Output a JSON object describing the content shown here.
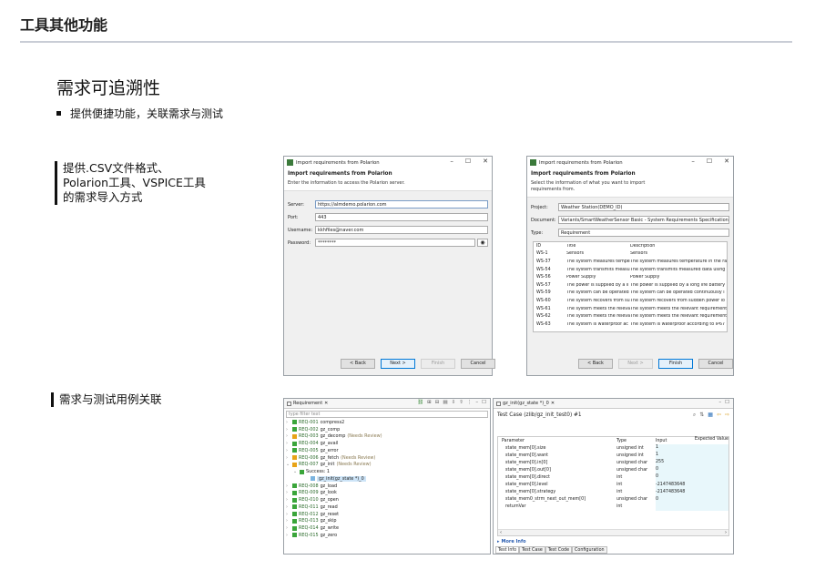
{
  "slide": {
    "title": "工具其他功能",
    "heading": "需求可追溯性",
    "bullet": "提供便捷功能，关联需求与测试",
    "csv_label": [
      "提供.CSV文件格式、",
      "Polarion工具、VSPICE工具",
      "的需求导入方式"
    ],
    "link_label": "需求与测试用例关联"
  },
  "dialog1": {
    "window_title": "Import requirements from Polarion",
    "heading": "Import requirements from Polarion",
    "subheading": "Enter the information to access the Polarion server.",
    "fields": [
      {
        "label": "Server:",
        "value": "https://almdemo.polarion.com"
      },
      {
        "label": "Port:",
        "value": "443"
      },
      {
        "label": "Username:",
        "value": "kkhfiles@naver.com"
      },
      {
        "label": "Password:",
        "value": "********"
      }
    ],
    "buttons": {
      "back": "< Back",
      "next": "Next >",
      "finish": "Finish",
      "cancel": "Cancel"
    }
  },
  "dialog2": {
    "window_title": "Import requirements from Polarion",
    "heading": "Import requirements from Polarion",
    "subheading": "Select the information of what you want to import requirements from.",
    "fields": [
      {
        "label": "Project:",
        "value": "Weather Station(DEMO_ID)"
      },
      {
        "label": "Document:",
        "value": "Variants/SmartWeatherSensor Basic - System Requirements Specification"
      },
      {
        "label": "Type:",
        "value": "Requirement"
      }
    ],
    "columns": [
      "ID",
      "Title",
      "Description"
    ],
    "rows": [
      [
        "WS-1",
        "Sensors",
        "Sensors"
      ],
      [
        "WS-37",
        "The system measures tempe",
        "The system measures temperature in the ra"
      ],
      [
        "WS-54",
        "The system transmits measu",
        "The system transmits measured data using"
      ],
      [
        "WS-56",
        "Power Supply",
        "Power Supply"
      ],
      [
        "WS-57",
        "The power is supplied by a li",
        "The power is supplied by a long life battery"
      ],
      [
        "WS-59",
        "The system can be operated",
        "The system can be operated continuously i"
      ],
      [
        "WS-60",
        "The system recovers from su",
        "The system recovers from sudden power lo"
      ],
      [
        "WS-61",
        "The system meets the releva",
        "The system meets the relevant requirement"
      ],
      [
        "WS-62",
        "The system meets the releva",
        "The system meets the relevant requirement"
      ],
      [
        "WS-63",
        "The system is waterproof ac",
        "The system is waterproof according to IP67"
      ]
    ],
    "buttons": {
      "back": "< Back",
      "next": "Next >",
      "finish": "Finish",
      "cancel": "Cancel"
    }
  },
  "req_view": {
    "tab": "Requirement",
    "filter_placeholder": "type filter text",
    "items": [
      {
        "id": "REQ-001",
        "name": "compress2",
        "status": "ok",
        "note": ""
      },
      {
        "id": "REQ-002",
        "name": "gz_comp",
        "status": "ok",
        "note": ""
      },
      {
        "id": "REQ-003",
        "name": "gz_decomp",
        "status": "warn",
        "note": "(Needs Review)"
      },
      {
        "id": "REQ-004",
        "name": "gz_avail",
        "status": "ok",
        "note": ""
      },
      {
        "id": "REQ-005",
        "name": "gz_error",
        "status": "ok",
        "note": ""
      },
      {
        "id": "REQ-006",
        "name": "gz_fetch",
        "status": "warn",
        "note": "(Needs Review)"
      },
      {
        "id": "REQ-007",
        "name": "gz_init",
        "status": "warn",
        "note": "(Needs Review)"
      },
      {
        "id": "",
        "name": "Success: 1",
        "status": "child",
        "note": ""
      },
      {
        "id": "",
        "name": "gz_init(gz_state *)_0",
        "status": "leaf",
        "note": ""
      },
      {
        "id": "REQ-008",
        "name": "gz_load",
        "status": "ok",
        "note": ""
      },
      {
        "id": "REQ-009",
        "name": "gz_look",
        "status": "ok",
        "note": ""
      },
      {
        "id": "REQ-010",
        "name": "gz_open",
        "status": "ok",
        "note": ""
      },
      {
        "id": "REQ-011",
        "name": "gz_read",
        "status": "ok",
        "note": ""
      },
      {
        "id": "REQ-012",
        "name": "gz_reset",
        "status": "ok",
        "note": ""
      },
      {
        "id": "REQ-013",
        "name": "gz_skip",
        "status": "ok",
        "note": ""
      },
      {
        "id": "REQ-014",
        "name": "gz_write",
        "status": "ok",
        "note": ""
      },
      {
        "id": "REQ-015",
        "name": "gz_zero",
        "status": "ok",
        "note": ""
      }
    ]
  },
  "test_view": {
    "tab": "gz_init(gz_state *)_0",
    "header": "Test Case (zlib/gz_init_test0) #1",
    "columns": [
      "Parameter",
      "Type",
      "Input",
      "Expected Value"
    ],
    "rows": [
      [
        "state_mem[0].size",
        "unsigned int",
        "1"
      ],
      [
        "state_mem[0].want",
        "unsigned int",
        "1"
      ],
      [
        "state_mem[0].in[0]",
        "unsigned char",
        "255"
      ],
      [
        "state_mem[0].out[0]",
        "unsigned char",
        "0"
      ],
      [
        "state_mem[0].direct",
        "int",
        "0"
      ],
      [
        "state_mem[0].level",
        "int",
        "-2147483648"
      ],
      [
        "state_mem[0].strategy",
        "int",
        "-2147483648"
      ],
      [
        "state_mem0_strm_next_out_mem[0]",
        "unsigned char",
        "0"
      ],
      [
        "returnVar",
        "int",
        ""
      ]
    ],
    "more_info": "More Info",
    "bottom_tabs": [
      "Test Info",
      "Test Case",
      "Test Code",
      "Configuration"
    ]
  }
}
